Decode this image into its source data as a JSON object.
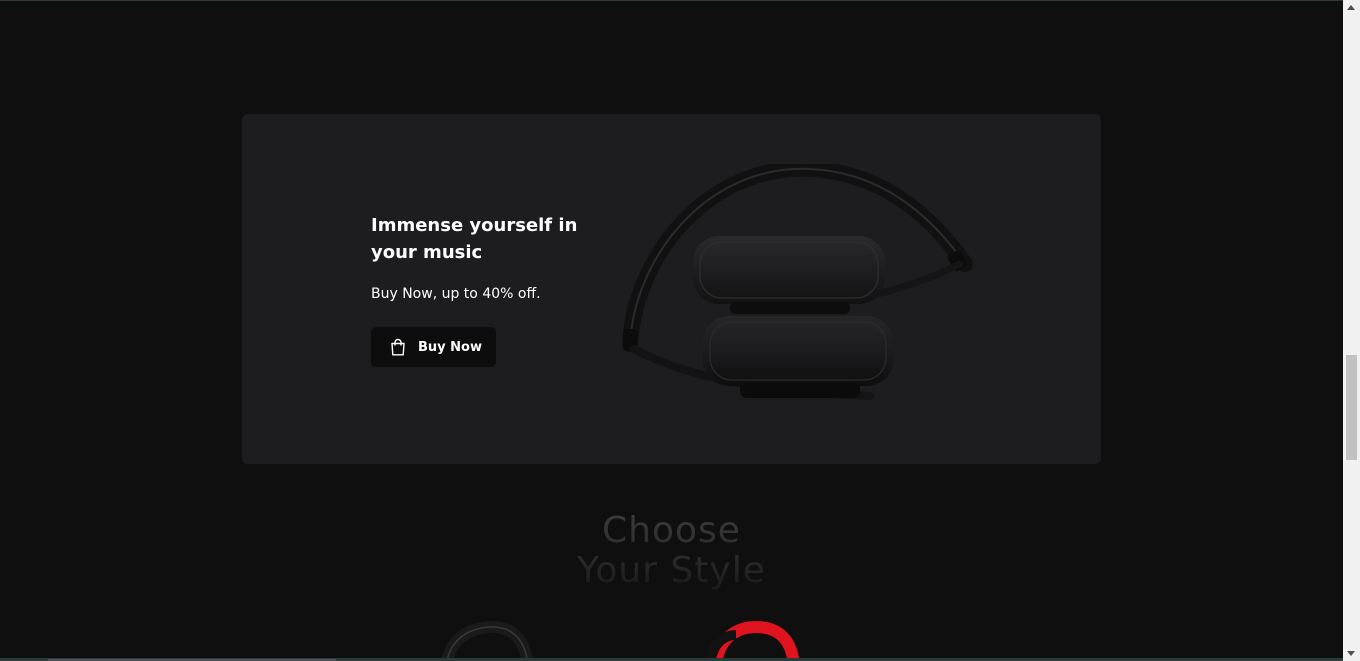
{
  "promo": {
    "title": "Immense yourself in your music",
    "subtitle": "Buy Now, up to 40% off.",
    "button_label": "Buy Now",
    "button_icon": "shopping-bag-icon"
  },
  "section": {
    "heading_line1": "Choose",
    "heading_line2": "Your Style"
  },
  "colors": {
    "page_bg": "#0f0f0f",
    "card_bg": "#1d1d1f",
    "button_bg": "#0d0d0d",
    "accent_red": "#e0141e"
  }
}
